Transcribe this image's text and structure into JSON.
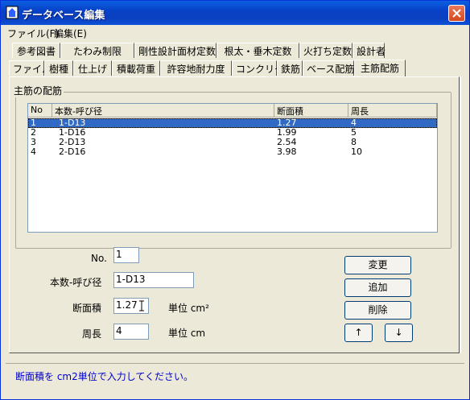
{
  "window": {
    "title": "データベース編集",
    "close_icon": "close-icon"
  },
  "menu": {
    "file": "ファイル(F)",
    "edit": "編集(E)"
  },
  "tabs_row1": [
    {
      "label": "参考図書"
    },
    {
      "label": "たわみ制限"
    },
    {
      "label": "剛性設計面材定数"
    },
    {
      "label": "根太・垂木定数"
    },
    {
      "label": "火打ち定数"
    },
    {
      "label": "設計者"
    }
  ],
  "tabs_row2": [
    {
      "label": "ファイル"
    },
    {
      "label": "樹種"
    },
    {
      "label": "仕上げ"
    },
    {
      "label": "積載荷重"
    },
    {
      "label": "許容地耐力度"
    },
    {
      "label": "コンクリート"
    },
    {
      "label": "鉄筋"
    },
    {
      "label": "ベース配筋"
    },
    {
      "label": "主筋配筋",
      "active": true
    }
  ],
  "group": {
    "label": "主筋の配筋"
  },
  "table": {
    "columns": [
      "No",
      "本数-呼び径",
      "断面積",
      "周長"
    ],
    "rows": [
      [
        "1",
        "1-D13",
        "1.27",
        "4"
      ],
      [
        "2",
        "1-D16",
        "1.99",
        "5"
      ],
      [
        "3",
        "2-D13",
        "2.54",
        "8"
      ],
      [
        "4",
        "2-D16",
        "3.98",
        "10"
      ]
    ],
    "selected_index": 0
  },
  "form": {
    "no_label": "No.",
    "no_value": "1",
    "bar_label": "本数-呼び径",
    "bar_value": "1-D13",
    "area_label": "断面積",
    "area_value": "1.27",
    "area_unit": "単位 cm²",
    "perimeter_label": "周長",
    "perimeter_value": "4",
    "perimeter_unit": "単位 cm"
  },
  "buttons": {
    "change": "変更",
    "add": "追加",
    "delete": "削除",
    "up": "↑",
    "down": "↓"
  },
  "status": {
    "message": "断面積を cm2単位で入力してください。"
  },
  "colors": {
    "title_bar": "#0842c8",
    "selection": "#316ac5",
    "status_text": "#0000cc"
  }
}
